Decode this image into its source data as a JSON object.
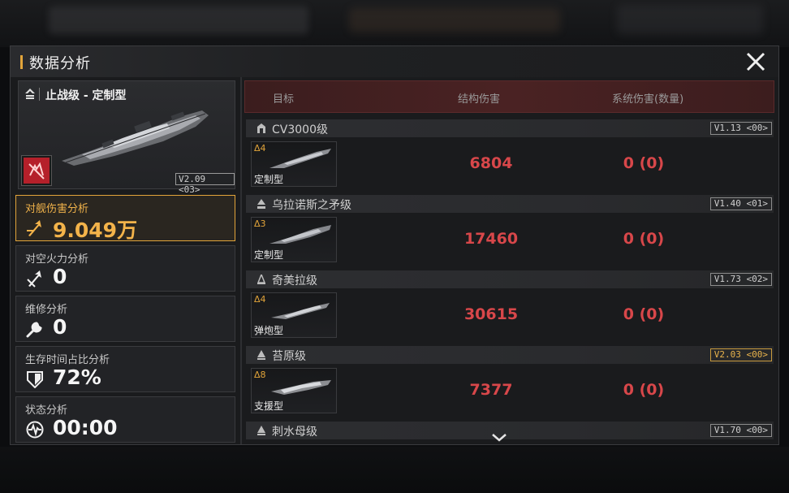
{
  "dialog": {
    "title": "数据分析"
  },
  "ship": {
    "name": "止战级 - 定制型",
    "version": "V2.09 <03>"
  },
  "stats": [
    {
      "label": "对舰伤害分析",
      "value": "9.049万",
      "icon": "anti-ship-arrow-icon",
      "active": true
    },
    {
      "label": "对空火力分析",
      "value": "0",
      "icon": "anti-air-arrow-icon",
      "active": false
    },
    {
      "label": "维修分析",
      "value": "0",
      "icon": "wrench-icon",
      "active": false
    },
    {
      "label": "生存时间占比分析",
      "value": "72%",
      "icon": "shield-icon",
      "active": false
    },
    {
      "label": "状态分析",
      "value": "00:00",
      "icon": "pulse-icon",
      "active": false
    }
  ],
  "table": {
    "headers": {
      "target": "目标",
      "structure_damage": "结构伤害",
      "system_damage": "系统伤害(数量)"
    },
    "rows": [
      {
        "class_name": "CV3000级",
        "class_icon": "carrier-icon",
        "version": "V1.13 <00>",
        "version_gold": false,
        "delta": "Δ4",
        "variant": "定制型",
        "structure_damage": "6804",
        "system_damage": "0 (0)"
      },
      {
        "class_name": "乌拉诺斯之矛级",
        "class_icon": "frigate-icon",
        "version": "V1.40 <01>",
        "version_gold": false,
        "delta": "Δ3",
        "variant": "定制型",
        "structure_damage": "17460",
        "system_damage": "0 (0)"
      },
      {
        "class_name": "奇美拉级",
        "class_icon": "destroyer-icon",
        "version": "V1.73 <02>",
        "version_gold": false,
        "delta": "Δ4",
        "variant": "弹炮型",
        "structure_damage": "30615",
        "system_damage": "0 (0)"
      },
      {
        "class_name": "苔原级",
        "class_icon": "cruiser-icon",
        "version": "V2.03 <00>",
        "version_gold": true,
        "delta": "Δ8",
        "variant": "支援型",
        "structure_damage": "7377",
        "system_damage": "0 (0)"
      },
      {
        "class_name": "刺水母级",
        "class_icon": "cruiser-icon",
        "version": "V1.70 <00>",
        "version_gold": false
      }
    ]
  },
  "colors": {
    "accent": "#e2a43a",
    "damage": "#d8474a",
    "header_red": "#4a2223"
  }
}
